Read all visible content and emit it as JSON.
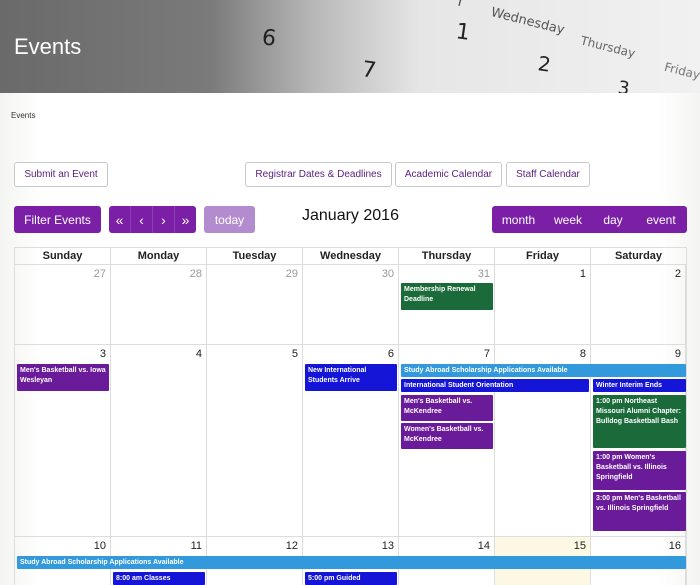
{
  "banner": {
    "title": "Events",
    "decor_text": [
      "6",
      "7",
      "1",
      "2",
      "3",
      "Wednesday",
      "Thursday",
      "Friday",
      "l"
    ]
  },
  "breadcrumb": "Events",
  "buttons": {
    "submit_event": "Submit an Event",
    "registrar": "Registrar Dates & Deadlines",
    "academic": "Academic Calendar",
    "staff": "Staff Calendar",
    "filter": "Filter Events",
    "today": "today",
    "nav": [
      "«",
      "‹",
      "›",
      "»"
    ],
    "views": {
      "month": "month",
      "week": "week",
      "day": "day",
      "event": "event"
    }
  },
  "calendar": {
    "title": "January 2016",
    "weekdays": [
      "Sunday",
      "Monday",
      "Tuesday",
      "Wednesday",
      "Thursday",
      "Friday",
      "Saturday"
    ],
    "weeks": [
      [
        "27",
        "28",
        "29",
        "30",
        "31",
        "1",
        "2"
      ],
      [
        "3",
        "4",
        "5",
        "6",
        "7",
        "8",
        "9"
      ],
      [
        "10",
        "11",
        "12",
        "13",
        "14",
        "15",
        "16"
      ]
    ],
    "events": {
      "membership": "Membership Renewal Deadline",
      "mens_bb_iowa": "Men's Basketball vs. Iowa Wesleyan",
      "new_intl": "New International Students Arrive",
      "study_abroad_1": "Study Abroad Scholarship Applications Available",
      "intl_orientation": "International Student Orientation",
      "winter_interim": "Winter Interim Ends",
      "mens_bb_mck": "Men's Basketball vs. McKendree",
      "womens_bb_mck": "Women's Basketball vs. McKendree",
      "alumni": "1:00 pm Northeast Missouri Alumni Chapter: Bulldog Basketball Bash",
      "womens_bb_ill": "1:00 pm Women's Basketball vs. Illinois Springfield",
      "mens_bb_ill": "3:00 pm Men's Basketball vs. Illinois Springfield",
      "study_abroad_2": "Study Abroad Scholarship Applications Available",
      "classes": "8:00 am Classes",
      "guided": "5:00 pm Guided"
    }
  },
  "colors": {
    "purple": "#7a1fa6",
    "event_purple": "#6a1b9a",
    "event_green": "#1b6b3a",
    "event_blue": "#1515d8",
    "event_lightblue": "#3399dd",
    "today_bg": "#fcf8e3"
  }
}
